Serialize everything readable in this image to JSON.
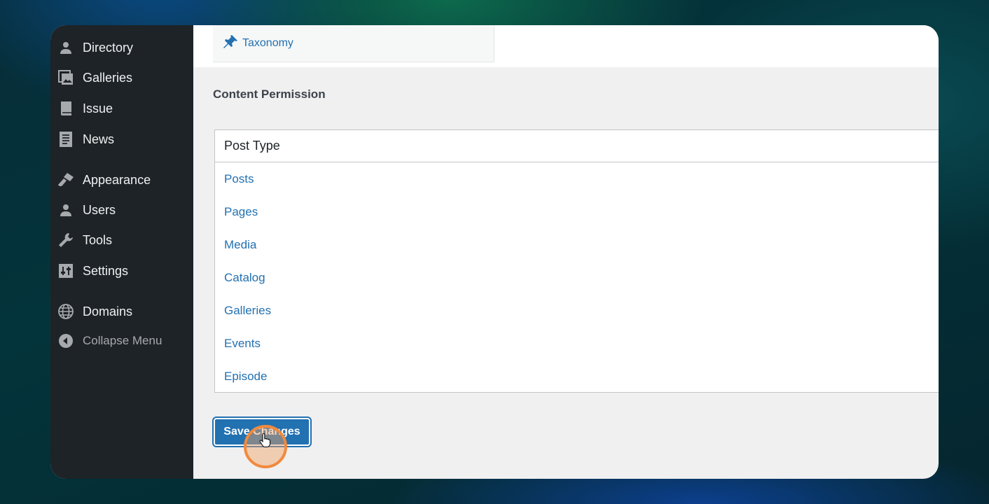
{
  "sidebar": {
    "items": [
      {
        "label": "Directory",
        "icon": "person-icon"
      },
      {
        "label": "Galleries",
        "icon": "gallery-icon"
      },
      {
        "label": "Issue",
        "icon": "book-icon"
      },
      {
        "label": "News",
        "icon": "document-icon"
      },
      {
        "label": "Appearance",
        "icon": "paintbrush-icon"
      },
      {
        "label": "Users",
        "icon": "users-icon"
      },
      {
        "label": "Tools",
        "icon": "wrench-icon"
      },
      {
        "label": "Settings",
        "icon": "settings-icon"
      },
      {
        "label": "Domains",
        "icon": "globe-icon"
      }
    ],
    "collapse_label": "Collapse Menu"
  },
  "taxonomy": {
    "label": "Taxonomy",
    "icon": "pin-icon"
  },
  "content_permission": {
    "title": "Content Permission",
    "column_header": "Post Type",
    "rows": [
      "Posts",
      "Pages",
      "Media",
      "Catalog",
      "Galleries",
      "Events",
      "Episode"
    ]
  },
  "save_button": {
    "label": "Save Changes"
  },
  "colors": {
    "sidebar_bg": "#1d2327",
    "link": "#2271b1",
    "button": "#2271b1",
    "click_indicator": "#f08a3e"
  }
}
